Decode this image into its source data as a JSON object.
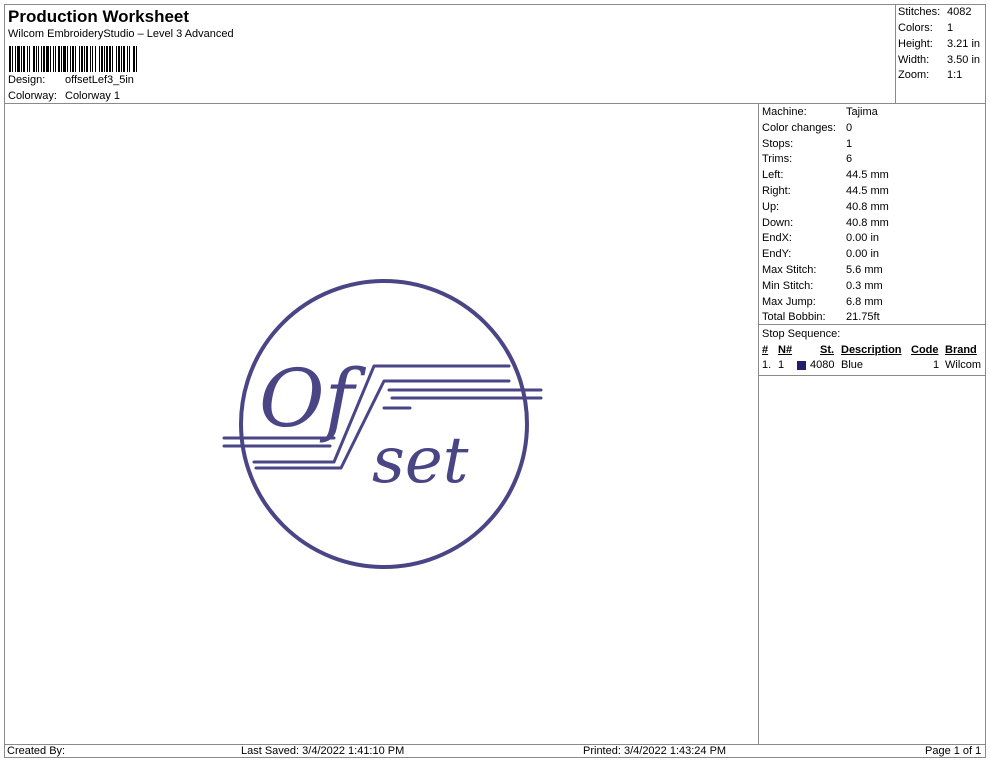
{
  "header": {
    "title": "Production Worksheet",
    "subtitle": "Wilcom EmbroideryStudio – Level 3 Advanced",
    "design_label": "Design:",
    "design_value": "offsetLef3_5in",
    "colorway_label": "Colorway:",
    "colorway_value": "Colorway 1"
  },
  "summary": {
    "stitches_label": "Stitches:",
    "stitches_value": "4082",
    "colors_label": "Colors:",
    "colors_value": "1",
    "height_label": "Height:",
    "height_value": "3.21 in",
    "width_label": "Width:",
    "width_value": "3.50 in",
    "zoom_label": "Zoom:",
    "zoom_value": "1:1"
  },
  "details": [
    {
      "label": "Machine:",
      "value": "Tajima"
    },
    {
      "label": "Color changes:",
      "value": "0"
    },
    {
      "label": "Stops:",
      "value": "1"
    },
    {
      "label": "Trims:",
      "value": "6"
    },
    {
      "label": "Left:",
      "value": "44.5 mm"
    },
    {
      "label": "Right:",
      "value": "44.5 mm"
    },
    {
      "label": "Up:",
      "value": "40.8 mm"
    },
    {
      "label": "Down:",
      "value": "40.8 mm"
    },
    {
      "label": "EndX:",
      "value": "0.00 in"
    },
    {
      "label": "EndY:",
      "value": "0.00 in"
    },
    {
      "label": "Max Stitch:",
      "value": "5.6 mm"
    },
    {
      "label": "Min Stitch:",
      "value": "0.3 mm"
    },
    {
      "label": "Max Jump:",
      "value": "6.8 mm"
    },
    {
      "label": "Total Bobbin:",
      "value": "21.75ft"
    }
  ],
  "stop_sequence": {
    "title": "Stop Sequence:",
    "headers": {
      "index": "#",
      "needle": "N#",
      "stitches": "St.",
      "description": "Description",
      "code": "Code",
      "brand": "Brand"
    },
    "rows": [
      {
        "index": "1.",
        "needle": "1",
        "stitches": "4080",
        "description": "Blue",
        "code": "1",
        "brand": "Wilcom",
        "color": "#1f1f6e"
      }
    ]
  },
  "design": {
    "text_of": "Of",
    "text_set": "set",
    "thread_color": "#4a4585"
  },
  "footer": {
    "created_by": "Created By:",
    "last_saved": "Last Saved: 3/4/2022 1:41:10 PM",
    "printed": "Printed: 3/4/2022 1:43:24 PM",
    "page": "Page 1 of 1"
  }
}
